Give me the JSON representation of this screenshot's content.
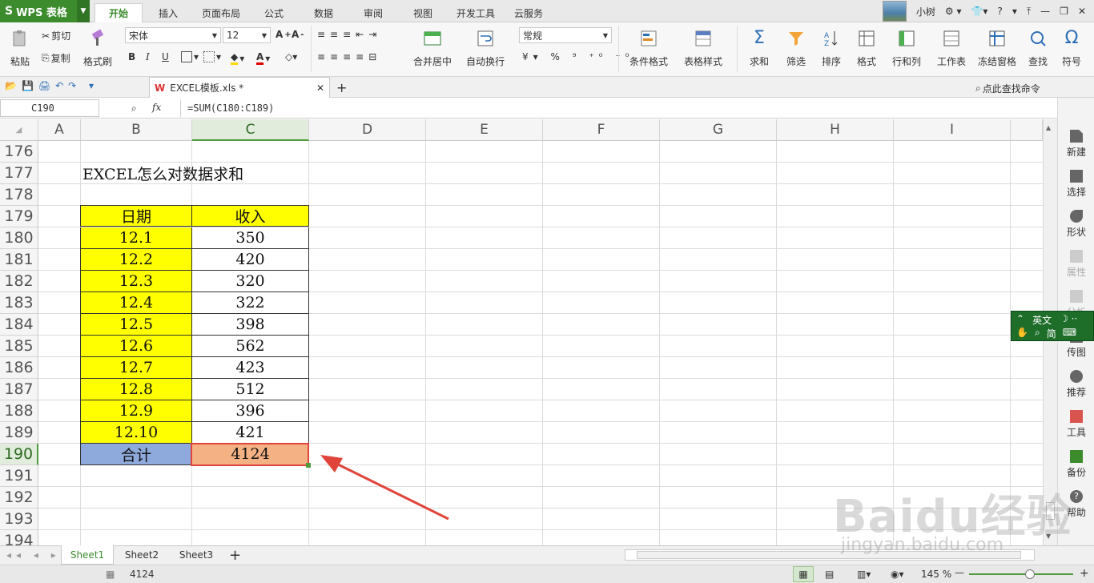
{
  "app": {
    "logo_text": "WPS 表格"
  },
  "menu": {
    "tabs": [
      "开始",
      "插入",
      "页面布局",
      "公式",
      "数据",
      "审阅",
      "视图",
      "开发工具",
      "云服务"
    ],
    "active": "开始"
  },
  "user": {
    "name": "小树",
    "help": "?"
  },
  "ribbon": {
    "paste": "粘贴",
    "cut": "剪切",
    "copy": "复制",
    "format_painter": "格式刷",
    "font_name": "宋体",
    "font_size": "12",
    "merge_center": "合并居中",
    "wrap_text": "自动换行",
    "number_format": "常规",
    "cond_format": "条件格式",
    "table_style": "表格样式",
    "sum": "求和",
    "filter": "筛选",
    "sort": "排序",
    "format": "格式",
    "row_col": "行和列",
    "worksheet": "工作表",
    "freeze": "冻结窗格",
    "find": "查找",
    "symbol": "符号"
  },
  "doc_tab": {
    "name": "EXCEL模板.xls *"
  },
  "search_cmd": "点此查找命令",
  "formula_bar": {
    "name_box": "C190",
    "fx": "fx",
    "formula": "=SUM(C180:C189)"
  },
  "columns": [
    "A",
    "B",
    "C",
    "D",
    "E",
    "F",
    "G",
    "H",
    "I"
  ],
  "rows": [
    "176",
    "177",
    "178",
    "179",
    "180",
    "181",
    "182",
    "183",
    "184",
    "185",
    "186",
    "187",
    "188",
    "189",
    "190",
    "191",
    "192",
    "193",
    "194"
  ],
  "sheet": {
    "title": "EXCEL怎么对数据求和",
    "header": {
      "date": "日期",
      "income": "收入"
    },
    "data": [
      {
        "date": "12.1",
        "income": "350"
      },
      {
        "date": "12.2",
        "income": "420"
      },
      {
        "date": "12.3",
        "income": "320"
      },
      {
        "date": "12.4",
        "income": "322"
      },
      {
        "date": "12.5",
        "income": "398"
      },
      {
        "date": "12.6",
        "income": "562"
      },
      {
        "date": "12.7",
        "income": "423"
      },
      {
        "date": "12.8",
        "income": "512"
      },
      {
        "date": "12.9",
        "income": "396"
      },
      {
        "date": "12.10",
        "income": "421"
      }
    ],
    "total_label": "合计",
    "total_value": "4124"
  },
  "sidebar": [
    "新建",
    "选择",
    "形状",
    "属性",
    "分析",
    "传图",
    "推荐",
    "工具",
    "备份",
    "帮助"
  ],
  "ime": {
    "lang": "英文",
    "mode": "简"
  },
  "sheet_tabs": [
    "Sheet1",
    "Sheet2",
    "Sheet3"
  ],
  "status": {
    "sum_value": "4124",
    "zoom": "145 %"
  },
  "watermark": {
    "main": "Baidu经验",
    "sub": "jingyan.baidu.com"
  },
  "colors": {
    "accent": "#3c8c2e",
    "yellow": "#ffff00",
    "blue": "#8ea9db",
    "orange": "#f4b183",
    "arrow": "#e0443a"
  }
}
